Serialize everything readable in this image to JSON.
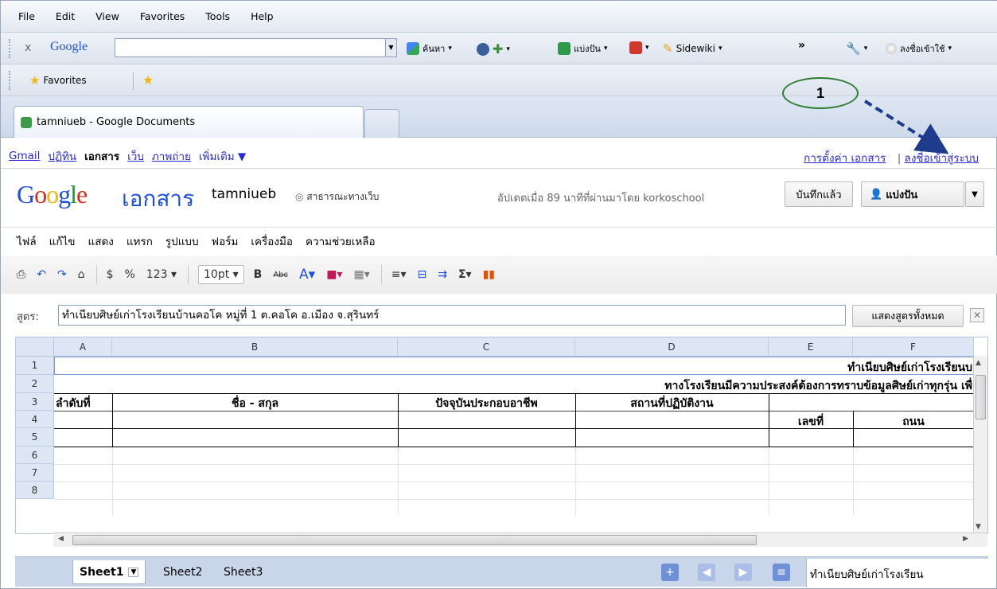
{
  "menu": [
    "File",
    "Edit",
    "View",
    "Favorites",
    "Tools",
    "Help"
  ],
  "google_toolbar": {
    "close": "x",
    "brand": "Google",
    "search_value": "",
    "search_btn": "ค้นหา",
    "share_btn": "แบ่งปัน",
    "sidewiki": "Sidewiki",
    "more": "»",
    "signin": "ลงชื่อเข้าใช้"
  },
  "favorites": {
    "label": "Favorites"
  },
  "tab": {
    "title": "tamniueb - Google Documents"
  },
  "docs_nav": {
    "links": [
      "Gmail",
      "ปฏิทิน",
      "เอกสาร",
      "เว็บ",
      "ภาพถ่าย",
      "เพิ่มเติม ▼"
    ],
    "settings": "การตั้งค่า เอกสาร",
    "signin": "ลงชื่อเข้าสู่ระบบ"
  },
  "docs_header": {
    "app_name": "เอกสาร",
    "doc_title": "tamniueb",
    "publish": "สาธารณะทางเว็บ",
    "updated": "อัปเดตเมื่อ 89 นาทีที่ผ่านมาโดย korkoschool",
    "saved_btn": "บันทึกแล้ว",
    "share_btn": "แบ่งปัน"
  },
  "docs_menu": [
    "ไฟล์",
    "แก้ไข",
    "แสดง",
    "แทรก",
    "รูปแบบ",
    "ฟอร์ม",
    "เครื่องมือ",
    "ความช่วยเหลือ"
  ],
  "toolbar": {
    "currency": "$",
    "percent": "%",
    "number": "123 ▾",
    "font_size": "10pt ▾",
    "bold": "B",
    "strike": "Abc"
  },
  "formula": {
    "label": "สูตร:",
    "value": "ทำเนียบศิษย์เก่าโรงเรียนบ้านคอโค  หมู่ที่ 1 ต.คอโค อ.เมือง จ.สุรินทร์",
    "show_all": "แสดงสูตรทั้งหมด",
    "close": "✕"
  },
  "grid": {
    "columns": [
      "A",
      "B",
      "C",
      "D",
      "E",
      "F"
    ],
    "rows": [
      "1",
      "2",
      "3",
      "4",
      "5",
      "6",
      "7",
      "8"
    ],
    "row1": "ทำเนียบศิษย์เก่าโรงเรียนบ",
    "row2": "ทางโรงเรียนมีความประสงค์ต้องการทราบข้อมูลศิษย์เก่าทุกรุ่น เพื่",
    "row3": [
      "ลำดับที่",
      "ชื่อ - สกุล",
      "ปัจจุบันประกอบอาชีพ",
      "สถานที่ปฏิบัติงาน"
    ],
    "row4": [
      "เลขที่",
      "ถนน"
    ]
  },
  "sheets": [
    "Sheet1",
    "Sheet2",
    "Sheet3"
  ],
  "sheet_status": "ทำเนียบศิษย์เก่าโรงเรียน",
  "annotation": {
    "label": "1"
  }
}
